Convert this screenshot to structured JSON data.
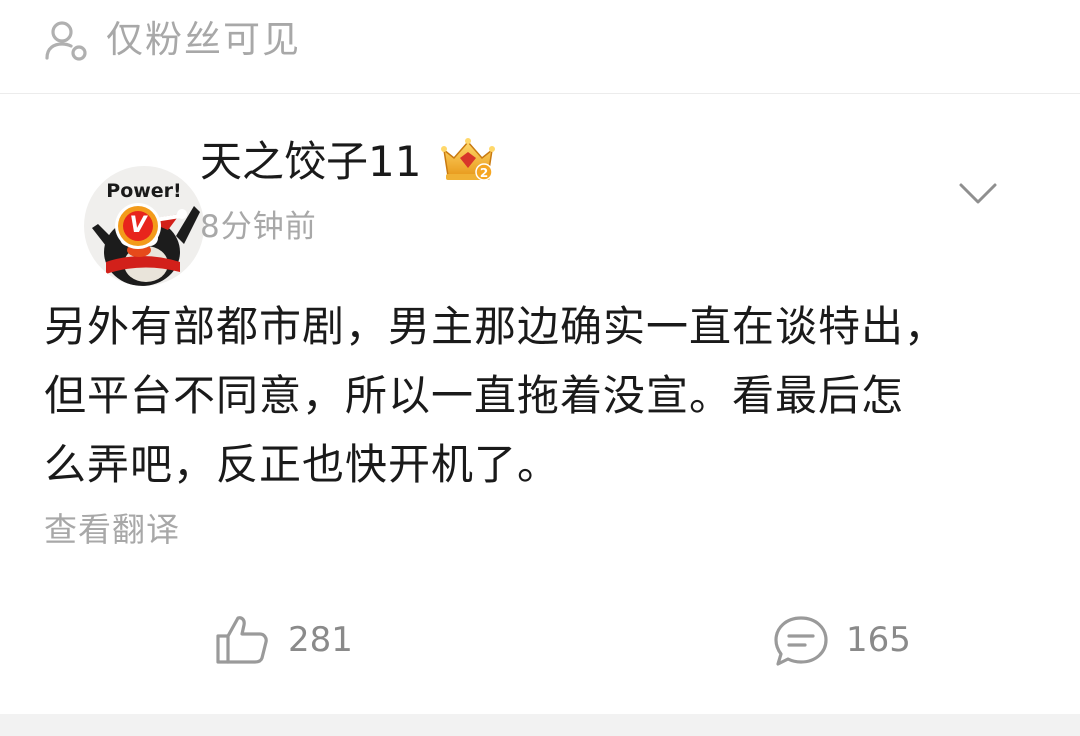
{
  "visibility": {
    "label": "仅粉丝可见",
    "icon": "person-icon"
  },
  "post": {
    "author": {
      "name": "天之饺子11",
      "avatar_text": "Power!",
      "verified_badge": "V",
      "crown_icon": "crown-badge-icon",
      "crown_level": "2"
    },
    "timestamp": "8分钟前",
    "content": "另外有部都市剧，男主那边确实一直在谈特出，\n但平台不同意，所以一直拖着没宣。看最后怎\n么弄吧，反正也快开机了。",
    "translate_label": "查看翻译",
    "actions": {
      "like_count": "281",
      "comment_count": "165"
    }
  },
  "colors": {
    "text_primary": "#1a1a1a",
    "text_secondary": "#a8a8a8",
    "badge_red": "#e8251c",
    "badge_orange": "#f39b1b"
  }
}
